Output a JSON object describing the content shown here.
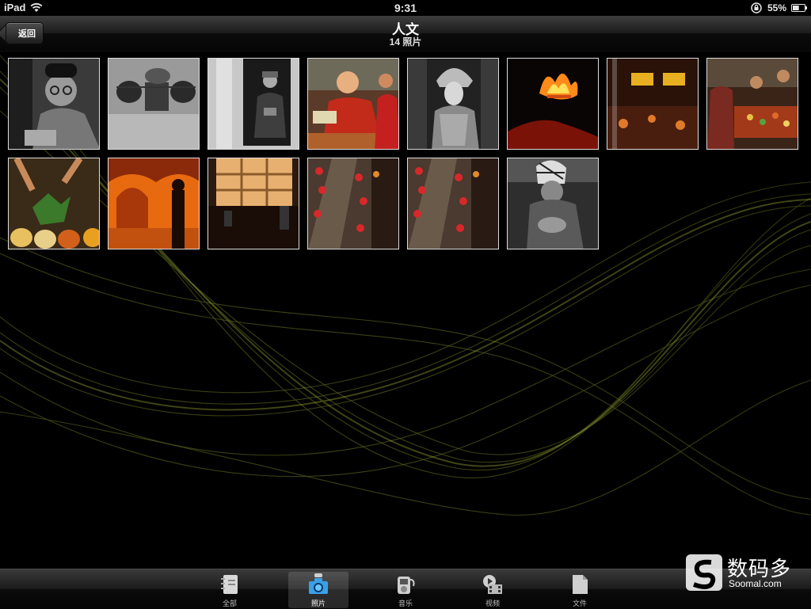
{
  "status_bar": {
    "carrier": "iPad",
    "time": "9:31",
    "battery_percent": "55%",
    "battery_level": 0.55,
    "icons": [
      "wifi-icon",
      "rotation-lock-icon",
      "battery-icon"
    ]
  },
  "nav": {
    "back_label": "返回",
    "title": "人文",
    "subtitle": "14 照片"
  },
  "photos": [
    {
      "subject": "elderly-man-portrait-bw"
    },
    {
      "subject": "woman-carrying-baskets-bw"
    },
    {
      "subject": "man-in-doorway-bw"
    },
    {
      "subject": "monk-in-red-robe"
    },
    {
      "subject": "opera-performer-headdress"
    },
    {
      "subject": "fire-flames-night"
    },
    {
      "subject": "night-street-stalls"
    },
    {
      "subject": "market-food-stall"
    },
    {
      "subject": "herbs-and-cups"
    },
    {
      "subject": "orange-arch-silhouette"
    },
    {
      "subject": "shop-interior-night"
    },
    {
      "subject": "lantern-alley"
    },
    {
      "subject": "lantern-alley-2"
    },
    {
      "subject": "woman-with-headwrap-bw"
    }
  ],
  "tabs": [
    {
      "label": "全部",
      "icon": "notebook-icon",
      "selected": false
    },
    {
      "label": "照片",
      "icon": "camera-icon",
      "selected": true
    },
    {
      "label": "音乐",
      "icon": "music-player-icon",
      "selected": false
    },
    {
      "label": "视频",
      "icon": "video-icon",
      "selected": false
    },
    {
      "label": "文件",
      "icon": "document-icon",
      "selected": false
    }
  ],
  "watermark": {
    "brand": "数码多",
    "site": "Soomal.com"
  },
  "colors": {
    "background": "#000000",
    "wave": "#8a9a2a",
    "selected_tab_icon": "#3aa0e8"
  }
}
